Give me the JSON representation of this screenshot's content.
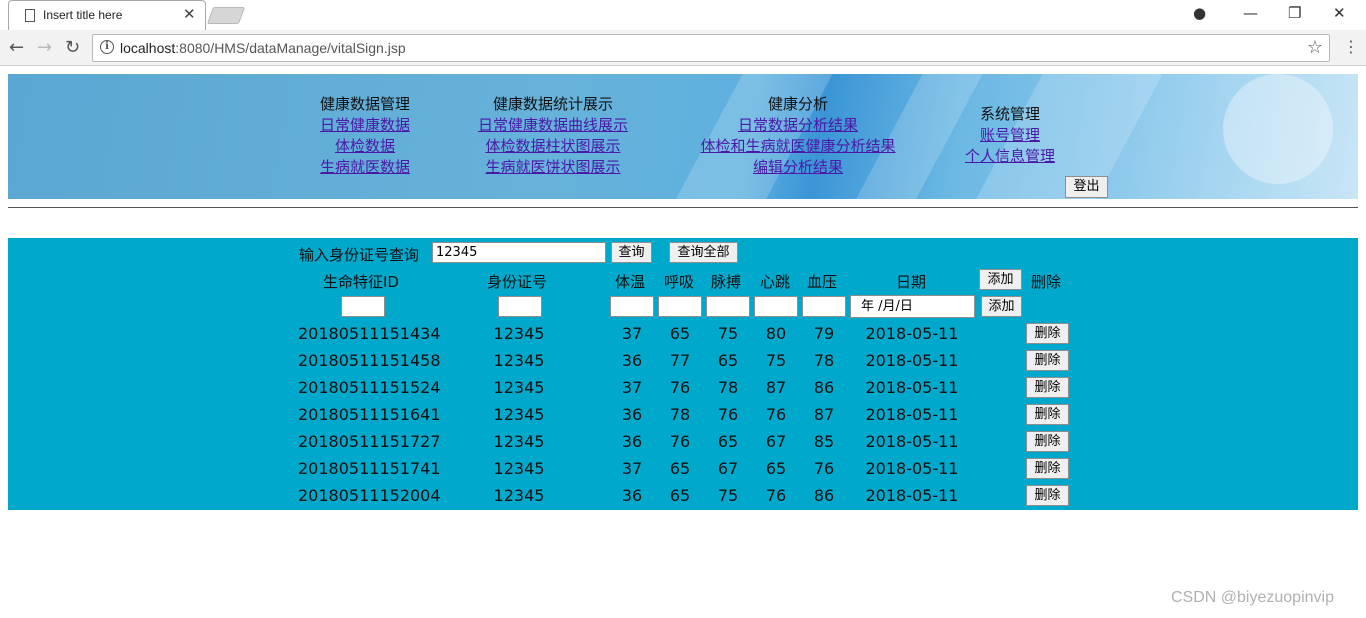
{
  "browser": {
    "tab_title": "Insert title here",
    "url_host": "localhost",
    "url_path": ":8080/HMS/dataManage/vitalSign.jsp"
  },
  "nav": {
    "col1": {
      "head": "健康数据管理",
      "links": [
        "日常健康数据",
        "体检数据",
        "生病就医数据"
      ]
    },
    "col2": {
      "head": "健康数据统计展示",
      "links": [
        "日常健康数据曲线展示",
        "体检数据柱状图展示",
        "生病就医饼状图展示"
      ]
    },
    "col3": {
      "head": "健康分析",
      "links": [
        "日常数据分析结果",
        "体检和生病就医健康分析结果",
        "编辑分析结果"
      ]
    },
    "col4": {
      "head": "系统管理",
      "links": [
        "账号管理",
        "个人信息管理"
      ]
    },
    "logout_label": "登出"
  },
  "search": {
    "label": "输入身份证号查询",
    "value": "12345",
    "query_label": "查询",
    "query_all_label": "查询全部"
  },
  "table": {
    "headers": [
      "生命特征ID",
      "身份证号",
      "体温",
      "呼吸",
      "脉搏",
      "心跳",
      "血压",
      "日期",
      "删除"
    ],
    "add_label": "添加",
    "date_placeholder": "年 /月/日",
    "delete_label": "删除",
    "rows": [
      [
        "20180511151434",
        "12345",
        "37",
        "65",
        "75",
        "80",
        "79",
        "2018-05-11"
      ],
      [
        "20180511151458",
        "12345",
        "36",
        "77",
        "65",
        "75",
        "78",
        "2018-05-11"
      ],
      [
        "20180511151524",
        "12345",
        "37",
        "76",
        "78",
        "87",
        "86",
        "2018-05-11"
      ],
      [
        "20180511151641",
        "12345",
        "36",
        "78",
        "76",
        "76",
        "87",
        "2018-05-11"
      ],
      [
        "20180511151727",
        "12345",
        "36",
        "76",
        "65",
        "67",
        "85",
        "2018-05-11"
      ],
      [
        "20180511151741",
        "12345",
        "37",
        "65",
        "67",
        "65",
        "76",
        "2018-05-11"
      ],
      [
        "20180511152004",
        "12345",
        "36",
        "65",
        "75",
        "76",
        "86",
        "2018-05-11"
      ]
    ]
  },
  "watermark": "CSDN @biyezuopinvip"
}
